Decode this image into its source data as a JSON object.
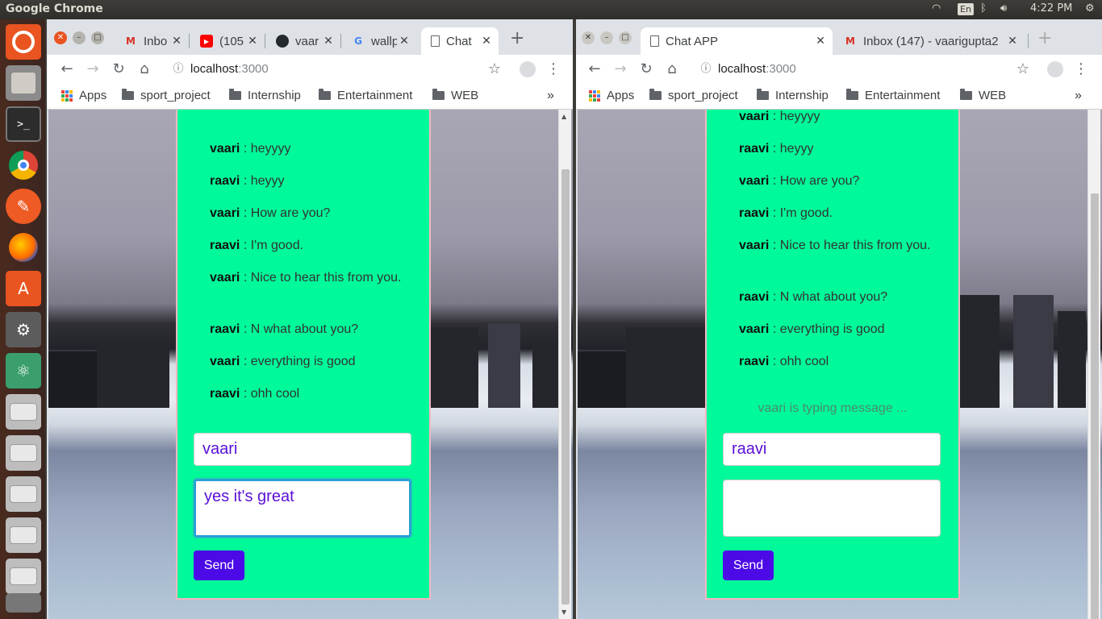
{
  "system": {
    "app_title": "Google Chrome",
    "keyboard": "En",
    "time": "4:22 PM"
  },
  "launcher": {
    "icons": [
      "ubuntu-icon",
      "files-icon",
      "terminal-icon",
      "chrome-icon",
      "postman-icon",
      "firefox-icon",
      "software-center-icon",
      "settings-icon",
      "atom-icon",
      "drive-icon",
      "drive-icon",
      "drive-icon",
      "drive-icon",
      "drive-icon",
      "trash-icon"
    ]
  },
  "left": {
    "tabs": [
      {
        "label": "Inbo",
        "icon": "gmail-icon"
      },
      {
        "label": "(105",
        "icon": "youtube-icon"
      },
      {
        "label": "vaar",
        "icon": "github-icon"
      },
      {
        "label": "wallp",
        "icon": "google-icon"
      },
      {
        "label": "Chat",
        "icon": "page-icon",
        "active": true
      }
    ],
    "url_host": "localhost",
    "url_port": ":3000",
    "bookmarks": {
      "apps": "Apps",
      "items": [
        "sport_project",
        "Internship",
        "Entertainment",
        "WEB"
      ],
      "more": "»"
    },
    "messages": [
      {
        "user": "vaari",
        "text": "heyyyy"
      },
      {
        "user": "raavi",
        "text": "heyyy"
      },
      {
        "user": "vaari",
        "text": "How are you?"
      },
      {
        "user": "raavi",
        "text": "I'm good."
      },
      {
        "user": "vaari",
        "text": "Nice to hear this from you."
      },
      {
        "user": "raavi",
        "text": "N what about you?"
      },
      {
        "user": "vaari",
        "text": "everything is good"
      },
      {
        "user": "raavi",
        "text": "ohh cool"
      }
    ],
    "name_value": "vaari",
    "message_value": "yes it's great",
    "send_label": "Send"
  },
  "right": {
    "tabs": [
      {
        "label": "Chat APP",
        "icon": "page-icon",
        "active": true
      },
      {
        "label": "Inbox (147) - vaarigupta2",
        "icon": "gmail-icon"
      }
    ],
    "url_host": "localhost",
    "url_port": ":3000",
    "bookmarks": {
      "apps": "Apps",
      "items": [
        "sport_project",
        "Internship",
        "Entertainment",
        "WEB"
      ],
      "more": "»"
    },
    "messages": [
      {
        "user": "vaari",
        "text": "heyyyy"
      },
      {
        "user": "raavi",
        "text": "heyyy"
      },
      {
        "user": "vaari",
        "text": "How are you?"
      },
      {
        "user": "raavi",
        "text": "I'm good."
      },
      {
        "user": "vaari",
        "text": "Nice to hear this from you."
      },
      {
        "user": "raavi",
        "text": "N what about you?"
      },
      {
        "user": "vaari",
        "text": "everything is good"
      },
      {
        "user": "raavi",
        "text": "ohh cool"
      }
    ],
    "typing": "vaari is typing message ...",
    "name_value": "raavi",
    "message_value": "",
    "send_label": "Send"
  },
  "colors": {
    "panel": "#00fa9a",
    "send": "#4b0ae6",
    "input_text": "#5a0fd8"
  }
}
